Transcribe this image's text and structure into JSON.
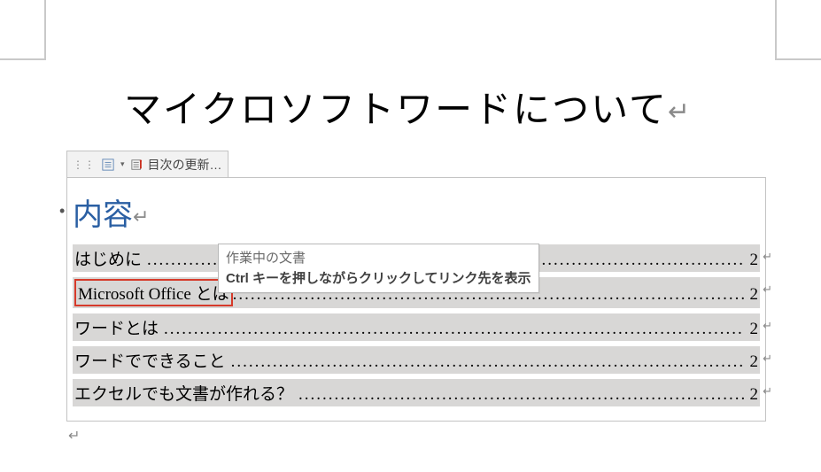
{
  "title": "マイクロソフトワードについて",
  "toc_tab": {
    "menu_icon_name": "toc-menu-icon",
    "update_icon_name": "refresh-icon",
    "update_label": "目次の更新…"
  },
  "toc": {
    "heading": "内容",
    "items": [
      {
        "label": "はじめに",
        "page": "2",
        "highlight": false
      },
      {
        "label": "Microsoft Office とは",
        "page": "2",
        "highlight": true
      },
      {
        "label": "ワードとは",
        "page": "2",
        "highlight": false
      },
      {
        "label": "ワードでできること",
        "page": "2",
        "highlight": false
      },
      {
        "label": "エクセルでも文書が作れる？",
        "page": "2",
        "highlight": false
      }
    ]
  },
  "tooltip": {
    "title": "作業中の文書",
    "body": "Ctrl キーを押しながらクリックしてリンク先を表示"
  },
  "glyphs": {
    "para": "↵",
    "eol": "↵",
    "caret": "▾",
    "grip": "⋮⋮"
  }
}
